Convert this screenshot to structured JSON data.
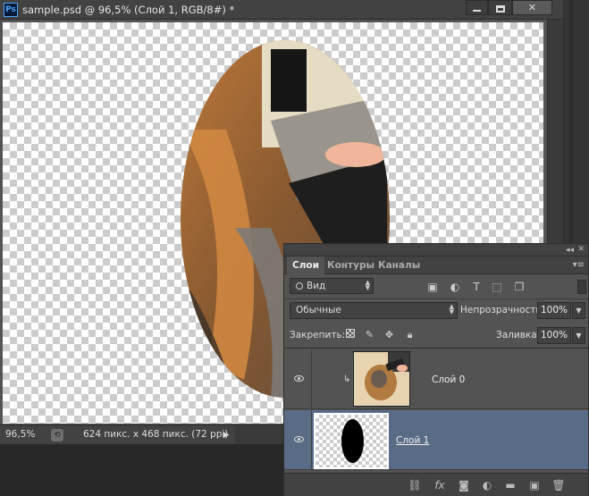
{
  "document": {
    "title": "sample.psd @ 96,5% (Слой 1, RGB/8#) *",
    "app_logo": "Ps"
  },
  "window_buttons": {
    "minimize_icon": "minimize-icon",
    "maximize_icon": "maximize-icon",
    "close_label": "✕"
  },
  "status": {
    "zoom": "96,5%",
    "doc_info": "624 пикс. x 468 пикс. (72 ppi)",
    "arrow": "▶"
  },
  "layers_panel": {
    "tabs": [
      {
        "label": "Слои",
        "active": true
      },
      {
        "label": "Контуры",
        "active": false
      },
      {
        "label": "Каналы",
        "active": false
      }
    ],
    "filter": {
      "label": "Вид"
    },
    "blend_mode": "Обычные",
    "opacity_label": "Непрозрачность:",
    "opacity_value": "100%",
    "lock_label": "Закрепить:",
    "fill_label": "Заливка:",
    "fill_value": "100%",
    "layers": [
      {
        "name": "Слой 0",
        "visible": true,
        "clipped": true,
        "selected": false
      },
      {
        "name": "Слой 1",
        "visible": true,
        "clipped": false,
        "selected": true
      }
    ]
  },
  "colors": {
    "workspace": "#535353",
    "selected_layer": "#5a6b86",
    "ps_blue": "#4fa3f7"
  }
}
